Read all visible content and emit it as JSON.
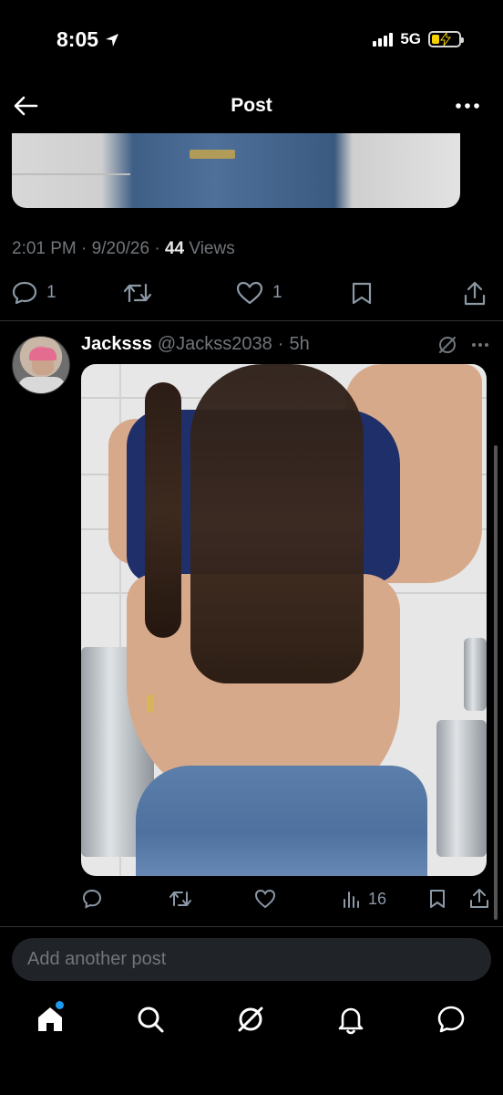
{
  "status_bar": {
    "time": "8:05",
    "network": "5G"
  },
  "header": {
    "title": "Post"
  },
  "post": {
    "time": "2:01 PM",
    "date": "9/20/26",
    "views_count": "44",
    "views_label": "Views",
    "replies": "1",
    "likes": "1"
  },
  "reply": {
    "name": "Jacksss",
    "handle": "@Jackss2038",
    "age": "5h",
    "views": "16"
  },
  "composer": {
    "placeholder": "Add another post"
  },
  "colors": {
    "accent": "#1d9bf0",
    "background": "#000000",
    "muted": "#71767b",
    "battery": "#f6d100"
  }
}
